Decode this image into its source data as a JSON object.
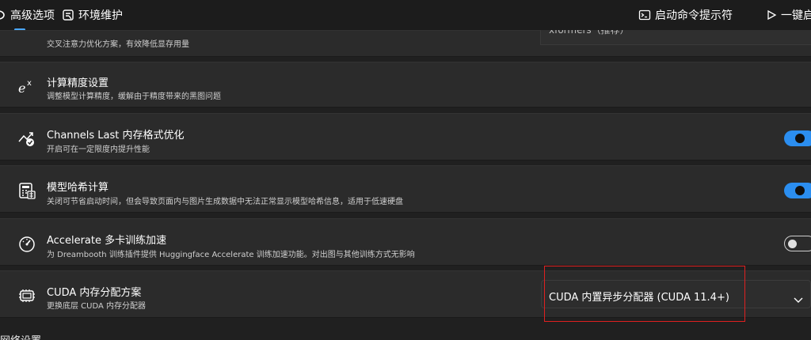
{
  "topbar": {
    "tab_advanced": "高级选项",
    "tab_env": "环境维护",
    "cmd_prompt": "启动命令提示符",
    "one_click": "一键启"
  },
  "cards": {
    "attention": {
      "desc": "交叉注意力优化方案，有效降低显存用量",
      "field_value": "xformers（推荐）"
    },
    "precision": {
      "title": "计算精度设置",
      "desc": "调整模型计算精度，缓解由于精度带来的黑图问题"
    },
    "channels_last": {
      "title": "Channels Last 内存格式优化",
      "desc": "开启可在一定限度内提升性能",
      "toggle": "on"
    },
    "model_hash": {
      "title": "模型哈希计算",
      "desc": "关闭可节省启动时间，但会导致页面内与图片生成数据中无法正常显示模型哈希信息，适用于低速硬盘",
      "toggle": "on"
    },
    "accelerate": {
      "title": "Accelerate 多卡训练加速",
      "desc": "为 Dreambooth 训练插件提供 Huggingface Accelerate 训练加速功能。对出图与其他训练方式无影响",
      "toggle": "off"
    },
    "cuda_alloc": {
      "title": "CUDA 内存分配方案",
      "desc": "更换底层 CUDA 内存分配器",
      "selected": "CUDA 内置异步分配器 (CUDA 11.4+)"
    }
  },
  "section": {
    "network": "网络设置"
  },
  "colors": {
    "accent": "#2b8ef0",
    "highlight": "#e02020",
    "card_bg": "#2b2b2b",
    "page_bg": "#202020"
  }
}
